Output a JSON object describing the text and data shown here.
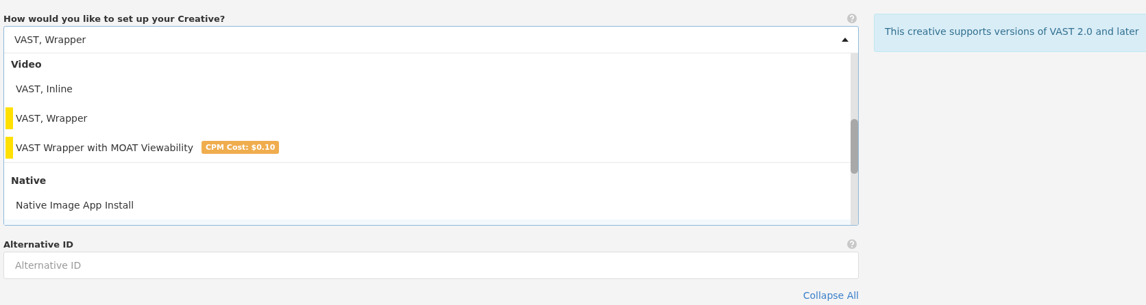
{
  "creative_setup": {
    "label": "How would you like to set up your Creative?",
    "value": "VAST, Wrapper",
    "expanded": true,
    "groups": [
      {
        "title": "Video",
        "options": [
          {
            "label": "VAST, Inline",
            "marked": false,
            "highlighted": false
          },
          {
            "label": "VAST, Wrapper",
            "marked": true,
            "highlighted": false
          },
          {
            "label": "VAST Wrapper with MOAT Viewability",
            "marked": true,
            "highlighted": false,
            "badge": "CPM Cost: $0.10"
          }
        ]
      },
      {
        "title": "Native",
        "options": [
          {
            "label": "Native Image App Install",
            "marked": false,
            "highlighted": false
          },
          {
            "marked": false,
            "highlighted": true
          }
        ]
      }
    ]
  },
  "info": "This creative supports versions of VAST 2.0 and later",
  "alternative_id": {
    "label": "Alternative ID",
    "placeholder": "Alternative ID"
  },
  "collapse_link": "Collapse All"
}
